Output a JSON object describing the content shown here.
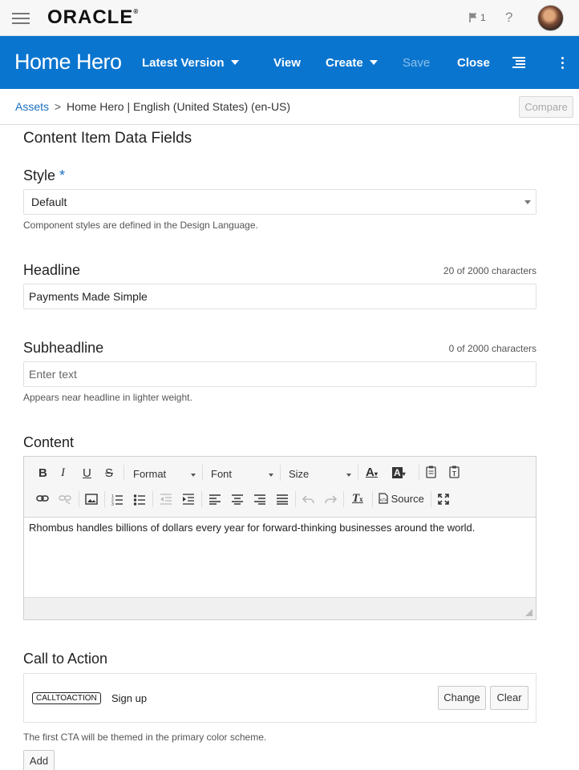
{
  "topbar": {
    "logo": "ORACLE",
    "logo_mark": "®",
    "flag_count": "1",
    "help": "?"
  },
  "toolbar": {
    "title": "Home Hero",
    "version": "Latest Version",
    "view": "View",
    "create": "Create",
    "save": "Save",
    "close": "Close"
  },
  "breadcrumb": {
    "root": "Assets",
    "separator": ">",
    "current": "Home Hero | English (United States) (en-US)",
    "compare": "Compare"
  },
  "form": {
    "section_title": "Content Item Data Fields",
    "style": {
      "label": "Style",
      "required_mark": "*",
      "value": "Default",
      "hint": "Component styles are defined in the Design Language."
    },
    "headline": {
      "label": "Headline",
      "counter": "20 of 2000 characters",
      "value": "Payments Made Simple"
    },
    "subheadline": {
      "label": "Subheadline",
      "counter": "0 of 2000 characters",
      "placeholder": "Enter text",
      "hint": "Appears near headline in lighter weight."
    },
    "content": {
      "label": "Content",
      "toolbar": {
        "bold": "B",
        "italic": "I",
        "underline": "U",
        "strike": "S",
        "format": "Format",
        "font": "Font",
        "size": "Size",
        "text_color": "A",
        "bg_color": "A",
        "source": "Source",
        "clear_format": "T"
      },
      "body": "Rhombus handles billions of dollars every year for forward-thinking businesses around the world."
    },
    "cta": {
      "label": "Call to Action",
      "tag": "CALLTOACTION",
      "text": "Sign up",
      "change": "Change",
      "clear": "Clear",
      "hint": "The first CTA will be themed in the primary color scheme.",
      "add": "Add"
    }
  },
  "colors": {
    "brand_blue": "#0a75cf",
    "link_blue": "#1a6fc0"
  }
}
